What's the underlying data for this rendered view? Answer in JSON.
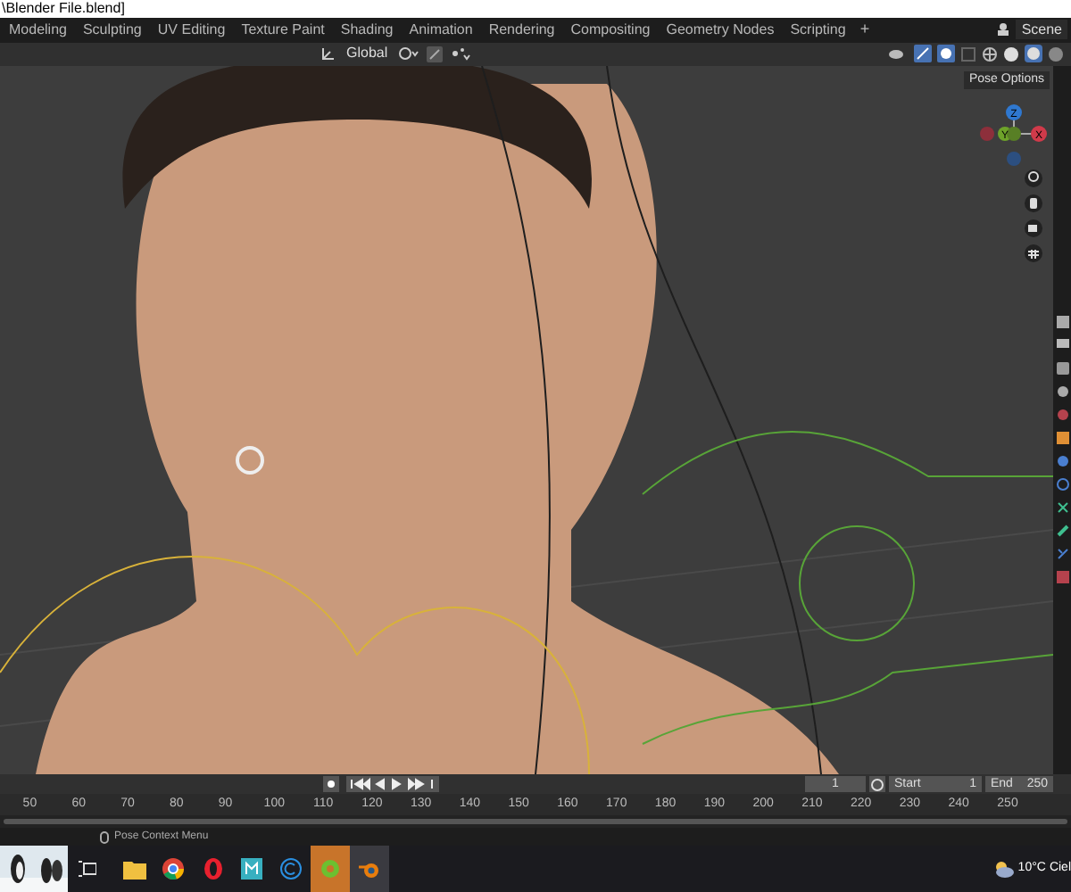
{
  "window": {
    "title": "\\Blender File.blend]"
  },
  "workspace_tabs": [
    {
      "label": "Modeling",
      "selected": false
    },
    {
      "label": "Sculpting",
      "selected": false
    },
    {
      "label": "UV Editing",
      "selected": false
    },
    {
      "label": "Texture Paint",
      "selected": false
    },
    {
      "label": "Shading",
      "selected": false
    },
    {
      "label": "Animation",
      "selected": false
    },
    {
      "label": "Rendering",
      "selected": false
    },
    {
      "label": "Compositing",
      "selected": false
    },
    {
      "label": "Geometry Nodes",
      "selected": false
    },
    {
      "label": "Scripting",
      "selected": false
    }
  ],
  "add_tab": "+",
  "scene": "Scene",
  "viewport_header": {
    "orientation": "Global"
  },
  "viewport": {
    "pose_options": "Pose Options",
    "gizmo_axes": [
      "Z",
      "Y",
      "X"
    ]
  },
  "timeline": {
    "current_frame": "1",
    "start_label": "Start",
    "start": "1",
    "end_label": "End",
    "end": "250",
    "ticks": [
      "50",
      "60",
      "70",
      "80",
      "90",
      "100",
      "110",
      "120",
      "130",
      "140",
      "150",
      "160",
      "170",
      "180",
      "190",
      "200",
      "210",
      "220",
      "230",
      "240",
      "250"
    ]
  },
  "status_bar": {
    "hint": "Pose Context Menu"
  },
  "taskbar": {
    "weather": "10°C",
    "weather_text": "Ciel"
  }
}
